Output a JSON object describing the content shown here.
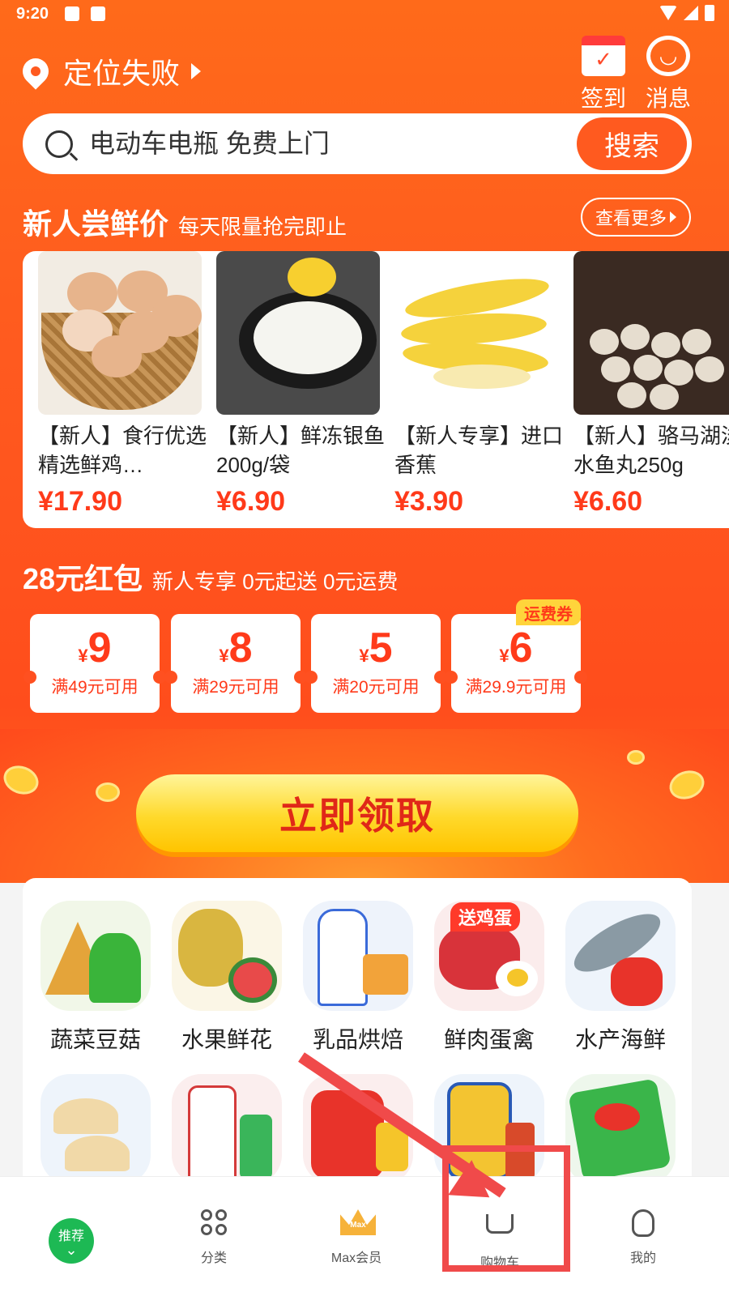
{
  "status_bar": {
    "time": "9:20"
  },
  "header": {
    "location": "定位失败",
    "checkin_label": "签到",
    "message_label": "消息"
  },
  "search": {
    "placeholder": "电动车电瓶 免费上门",
    "button": "搜索"
  },
  "new_user": {
    "title": "新人尝鲜价",
    "subtitle": "每天限量抢完即止",
    "more": "查看更多",
    "products": [
      {
        "name": "【新人】食行优选精选鲜鸡…",
        "price": "¥17.90"
      },
      {
        "name": "【新人】鲜冻银鱼200g/袋",
        "price": "¥6.90"
      },
      {
        "name": "【新人专享】进口香蕉",
        "price": "¥3.90"
      },
      {
        "name": "【新人】骆马湖淡水鱼丸250g",
        "price": "¥6.60"
      }
    ]
  },
  "red_packet": {
    "title": "28元红包",
    "subtitle": "新人专享 0元起送 0元运费",
    "currency": "¥",
    "shipping_tag": "运费券",
    "coupons": [
      {
        "amount": "9",
        "condition": "满49元可用"
      },
      {
        "amount": "8",
        "condition": "满29元可用"
      },
      {
        "amount": "5",
        "condition": "满20元可用"
      },
      {
        "amount": "6",
        "condition": "满29.9元可用"
      }
    ],
    "claim_button": "立即领取"
  },
  "categories": {
    "badge": "送鸡蛋",
    "items": [
      {
        "label": "蔬菜豆菇"
      },
      {
        "label": "水果鲜花"
      },
      {
        "label": "乳品烘焙"
      },
      {
        "label": "鲜肉蛋禽"
      },
      {
        "label": "水产海鲜"
      }
    ]
  },
  "bottom_nav": {
    "recommend": "推荐",
    "category": "分类",
    "max": "Max会员",
    "max_badge": "Max",
    "cart": "购物车",
    "mine": "我的"
  },
  "colors": {
    "brand_orange": "#ff5a1f",
    "price_red": "#ff3a1a",
    "nav_green": "#1db954",
    "annotation_red": "#f04a4a"
  }
}
